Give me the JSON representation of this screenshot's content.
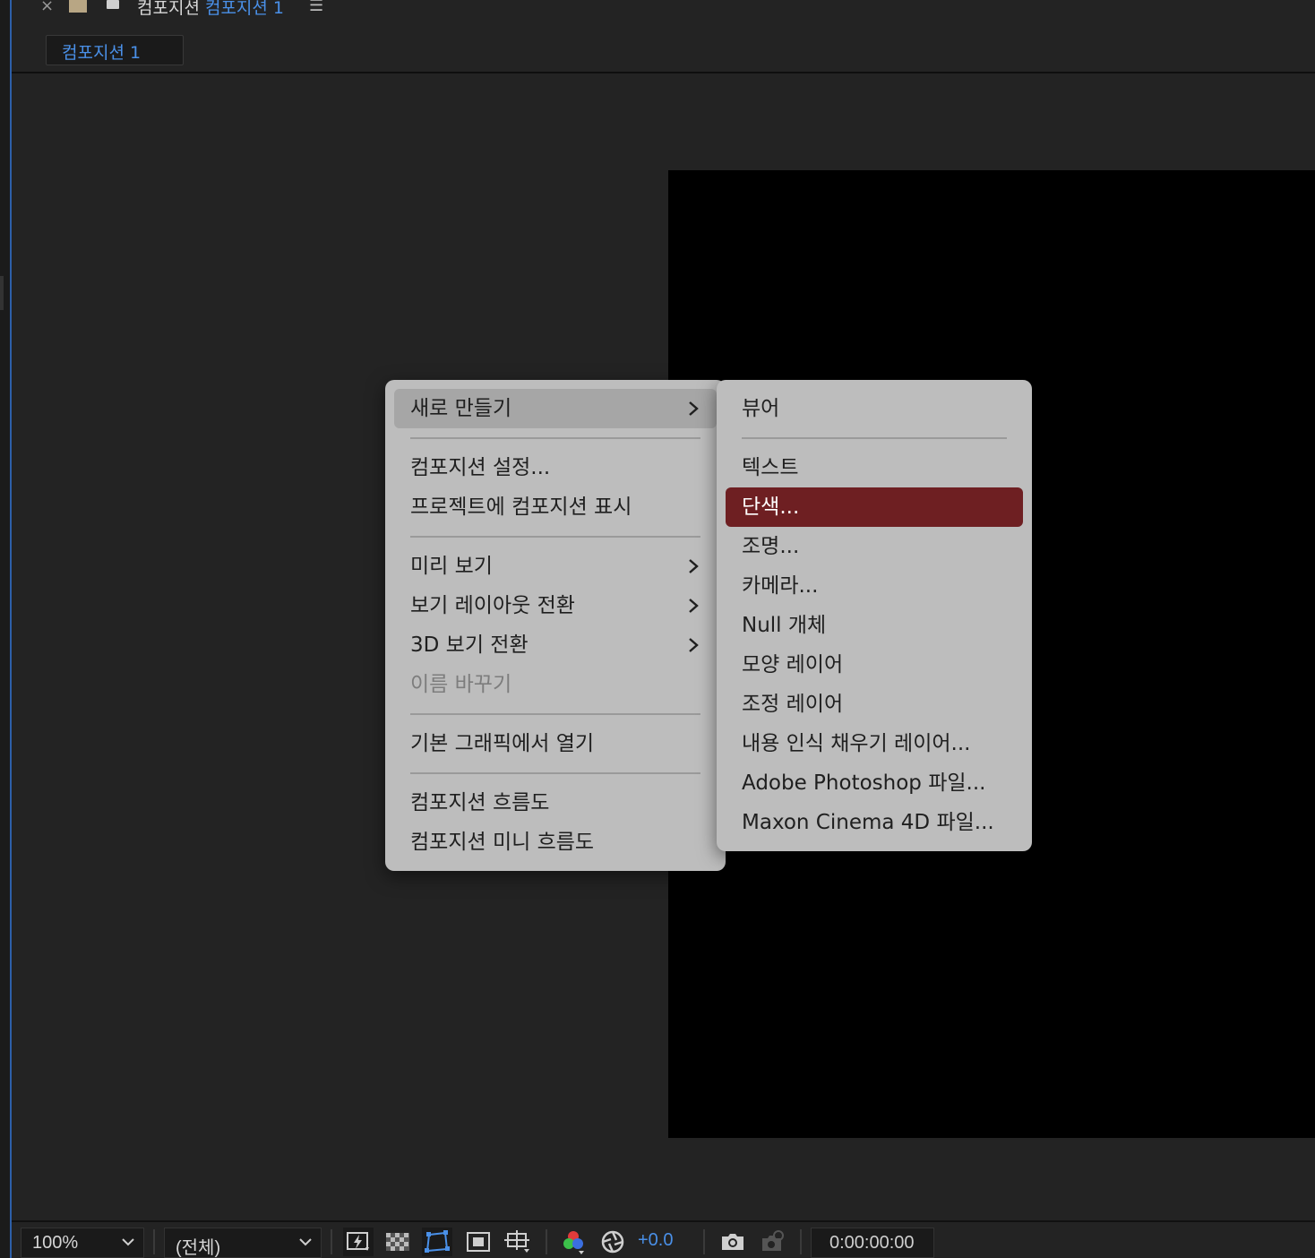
{
  "header": {
    "close_glyph": "×",
    "title_prefix": "컴포지션",
    "title_name": "컴포지션 1",
    "menu_glyph": "☰"
  },
  "tab": {
    "label": "컴포지션 1"
  },
  "context_menu": {
    "new": "새로 만들기",
    "comp_settings": "컴포지션 설정...",
    "reveal_in_project": "프로젝트에 컴포지션 표시",
    "preview": "미리 보기",
    "switch_view_layout": "보기 레이아웃 전환",
    "switch_3d_view": "3D 보기 전환",
    "rename": "이름 바꾸기",
    "open_in_essential_graphics": "기본 그래픽에서 열기",
    "comp_flowchart": "컴포지션 흐름도",
    "comp_mini_flowchart": "컴포지션 미니 흐름도"
  },
  "submenu": {
    "viewer": "뷰어",
    "text": "텍스트",
    "solid": "단색...",
    "light": "조명...",
    "camera": "카메라...",
    "null_object": "Null 개체",
    "shape_layer": "모양 레이어",
    "adjustment_layer": "조정 레이어",
    "content_aware_fill_layer": "내용 인식 채우기 레이어...",
    "photoshop_file": "Adobe Photoshop 파일...",
    "cinema4d_file": "Maxon Cinema 4D 파일..."
  },
  "toolbar": {
    "zoom": "100%",
    "resolution": "(전체)",
    "exposure": "+0.0",
    "timecode": "0:00:00:00"
  },
  "colors": {
    "accent_blue": "#4a90e8",
    "selected_red": "#6e1f22",
    "menu_bg": "#bdbdbd",
    "panel_bg": "#232323"
  }
}
